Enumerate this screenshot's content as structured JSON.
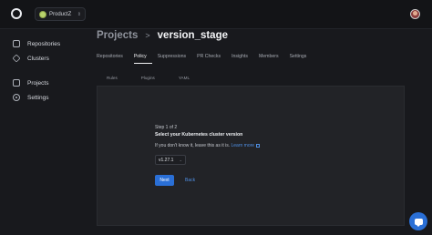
{
  "topbar": {
    "org_name": "ProductZ",
    "org_chevron_icon": "chevron-updown-icon",
    "logo_icon": "app-logo-icon",
    "avatar_icon": "user-avatar"
  },
  "sidebar": {
    "items": [
      {
        "label": "Repositories",
        "icon": "repository-icon"
      },
      {
        "label": "Clusters",
        "icon": "cube-icon"
      },
      {
        "label": "Projects",
        "icon": "grid-icon"
      },
      {
        "label": "Settings",
        "icon": "gear-icon"
      }
    ]
  },
  "breadcrumb": {
    "root": "Projects",
    "separator": ">",
    "current": "version_stage"
  },
  "tabs": [
    {
      "label": "Repositories",
      "active": false
    },
    {
      "label": "Policy",
      "active": true
    },
    {
      "label": "Suppressions",
      "active": false
    },
    {
      "label": "PR Checks",
      "active": false
    },
    {
      "label": "Insights",
      "active": false
    },
    {
      "label": "Members",
      "active": false
    },
    {
      "label": "Settings",
      "active": false
    }
  ],
  "subtabs": [
    "Rules",
    "Plugins",
    "YAML"
  ],
  "wizard": {
    "step": "Step 1 of 2",
    "title": "Select your Kubernetes cluster version",
    "help_text": "If you don't know it, leave this as it is.",
    "help_link": "Learn more",
    "version_value": "v1.27.1",
    "next_label": "Next",
    "back_label": "Back"
  },
  "colors": {
    "accent": "#2a6fd6",
    "link": "#4f8fe3",
    "background": "#18191d",
    "panel": "#222327"
  }
}
